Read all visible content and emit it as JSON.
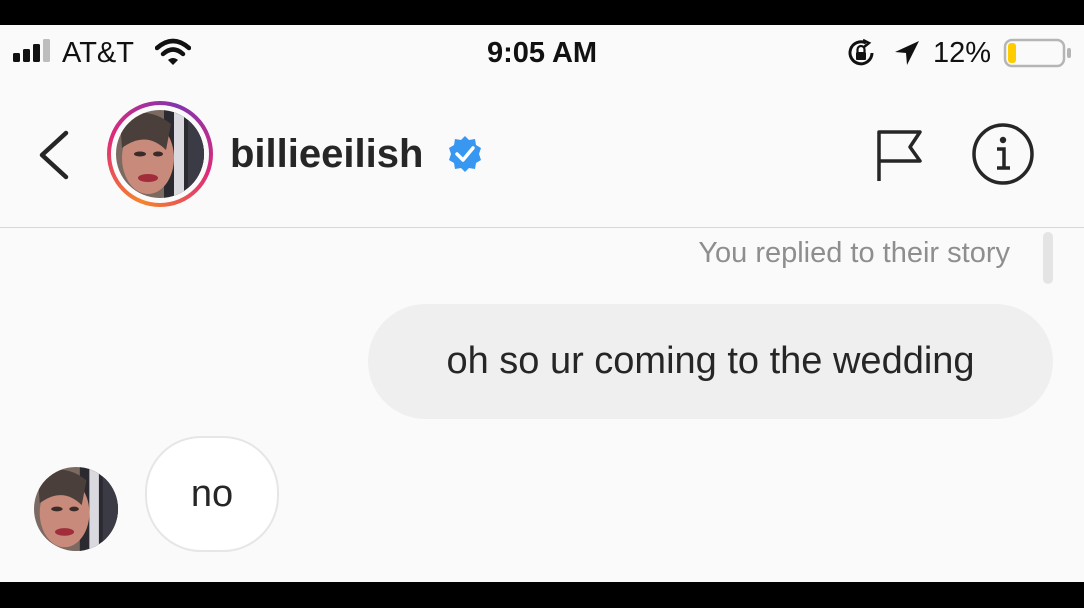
{
  "status_bar": {
    "carrier": "AT&T",
    "time": "9:05 AM",
    "battery_percent": "12%",
    "battery_level": 0.12,
    "icons": [
      "signal-icon",
      "wifi-icon",
      "rotation-lock-icon",
      "location-arrow-icon",
      "battery-icon"
    ]
  },
  "header": {
    "username": "billieeilish",
    "verified": true,
    "icons": [
      "back-chevron-icon",
      "verified-badge-icon",
      "flag-icon",
      "info-icon"
    ]
  },
  "thread": {
    "story_reply_label": "You replied to their story",
    "messages": [
      {
        "from": "me",
        "text": "oh so ur coming to the wedding"
      },
      {
        "from": "them",
        "text": "no"
      }
    ]
  },
  "colors": {
    "verified_blue": "#3897f0",
    "outgoing_bubble": "#efefef",
    "story_ring": [
      "#f58529",
      "#dd2a7b",
      "#8134af"
    ]
  }
}
